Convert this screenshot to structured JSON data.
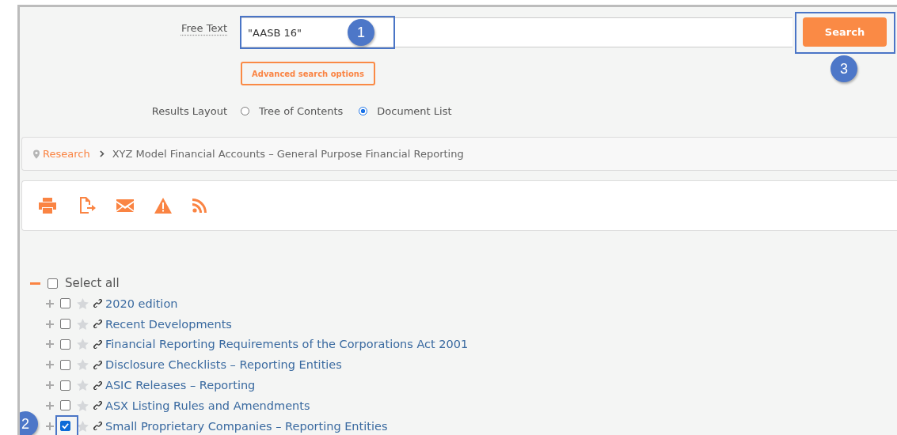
{
  "search": {
    "label": "Free Text",
    "value": "\"AASB 16\"",
    "field_callout": "1",
    "button": "Search",
    "button_callout": "3",
    "advanced": "Advanced search options"
  },
  "layout": {
    "label": "Results Layout",
    "options": [
      {
        "label": "Tree of Contents",
        "selected": false
      },
      {
        "label": "Document List",
        "selected": true
      }
    ]
  },
  "breadcrumb": {
    "root": "Research",
    "current": "XYZ Model Financial Accounts – General Purpose Financial Reporting"
  },
  "toolbar": [
    {
      "kind": "print"
    },
    {
      "kind": "export"
    },
    {
      "kind": "email"
    },
    {
      "kind": "alert"
    },
    {
      "kind": "rss"
    }
  ],
  "tree": {
    "label": "Select all",
    "expanded": true,
    "checked": false,
    "children": [
      {
        "label": "2020 edition",
        "checked": false
      },
      {
        "label": "Recent Developments",
        "checked": false
      },
      {
        "label": "Financial Reporting Requirements of the Corporations Act 2001",
        "checked": false
      },
      {
        "label": "Disclosure Checklists – Reporting Entities",
        "checked": false
      },
      {
        "label": "ASIC Releases – Reporting",
        "checked": false
      },
      {
        "label": "ASX Listing Rules and Amendments",
        "checked": false
      },
      {
        "label": "Small Proprietary Companies – Reporting Entities",
        "checked": true,
        "callout": "2"
      }
    ]
  }
}
